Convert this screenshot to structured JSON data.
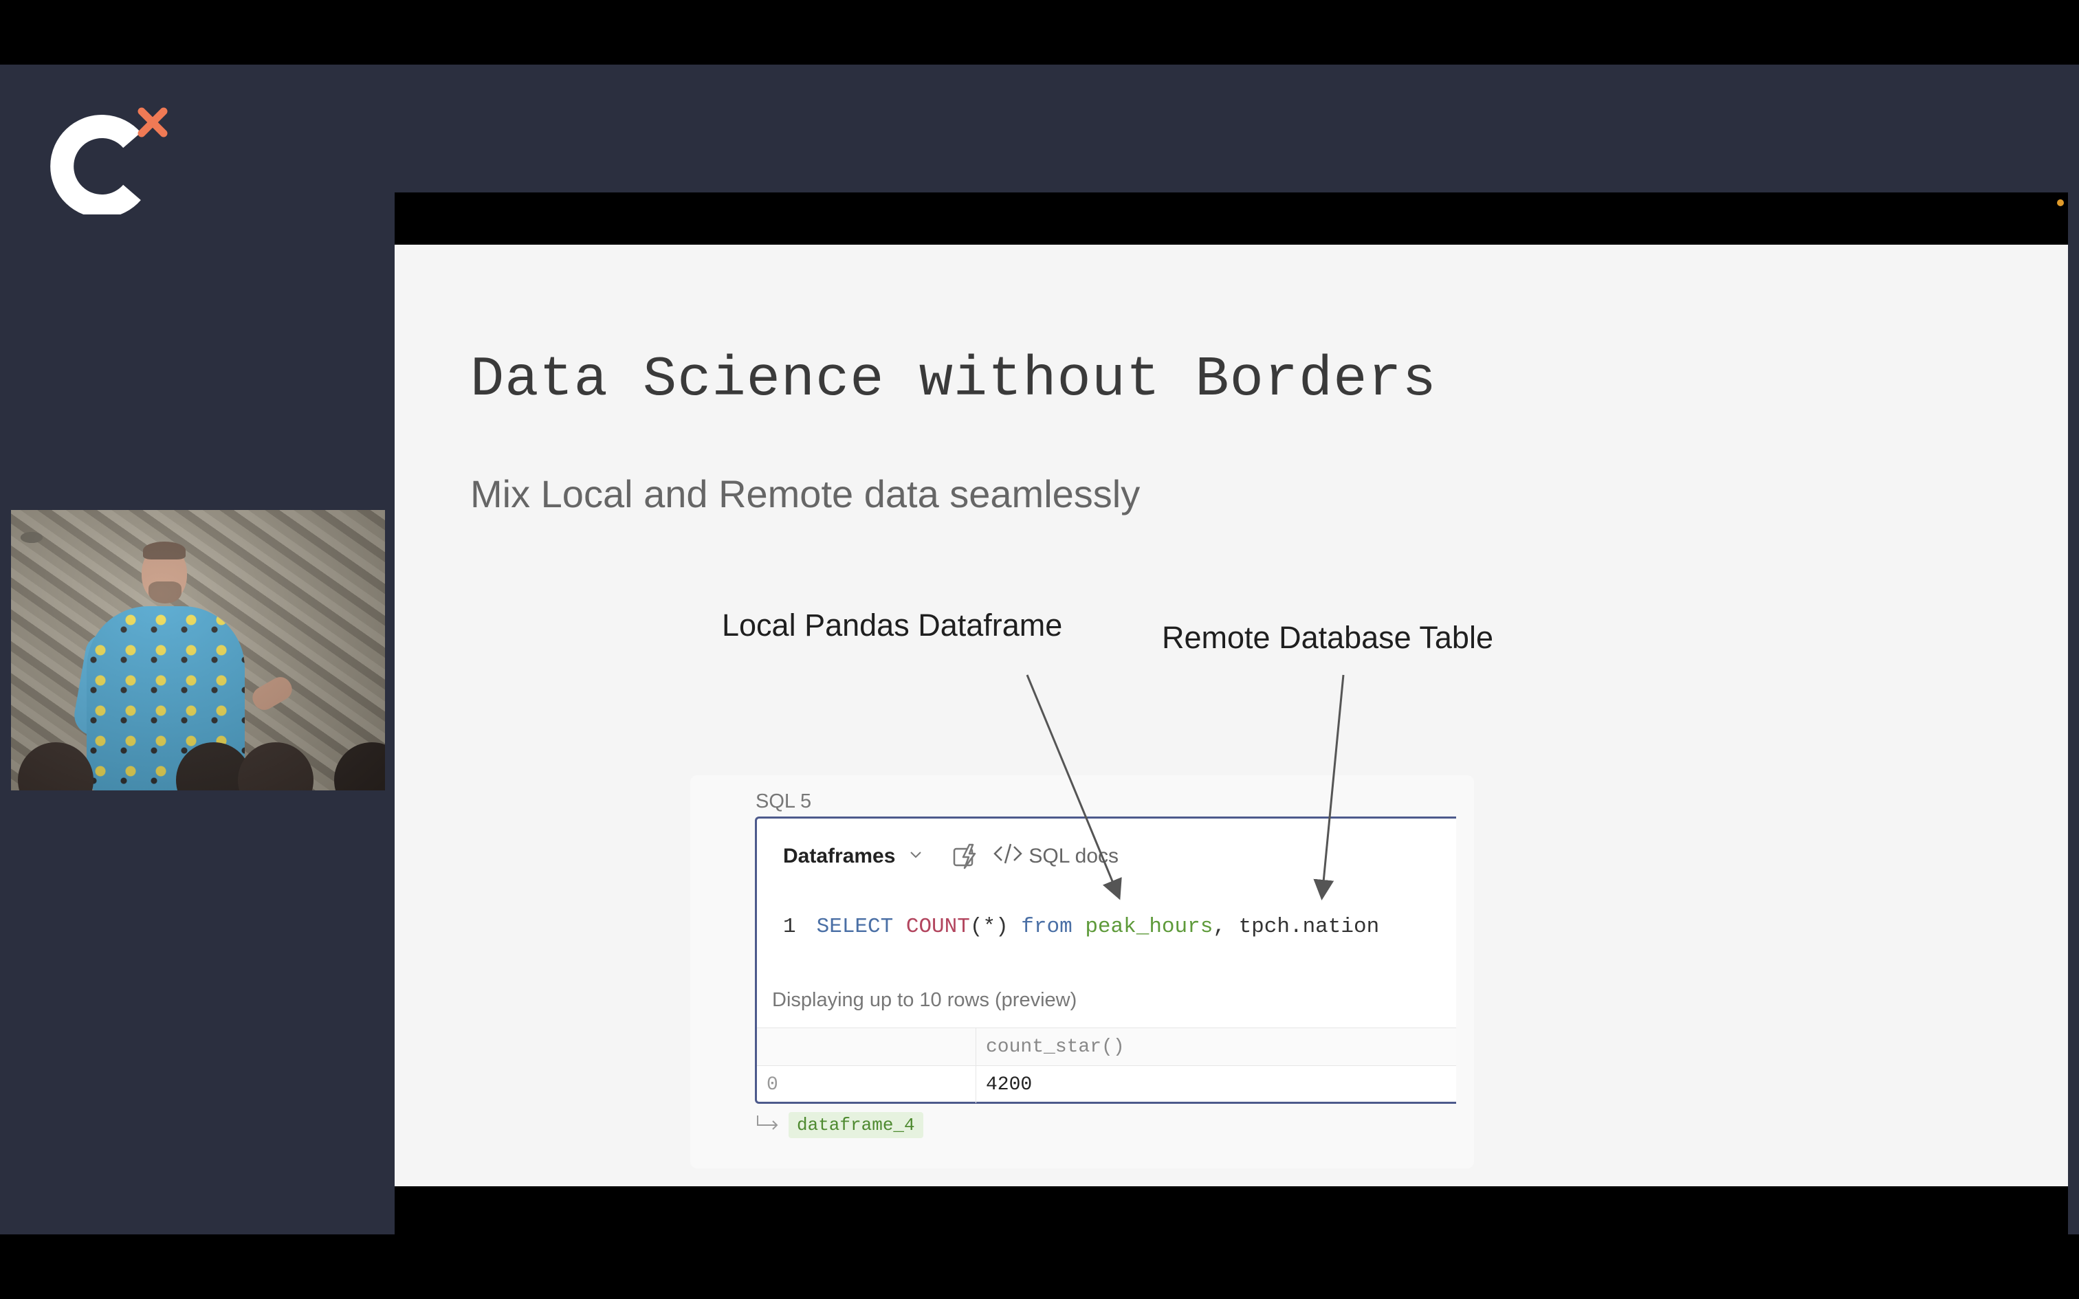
{
  "slide": {
    "title": "Data Science without Borders",
    "subtitle": "Mix Local and Remote data seamlessly",
    "callouts": {
      "local": "Local Pandas Dataframe",
      "remote": "Remote Database Table"
    }
  },
  "sql_cell": {
    "label": "SQL 5",
    "source_select": "Dataframes",
    "docs_link": "SQL docs",
    "code": {
      "line_number": "1",
      "tokens": {
        "select": "SELECT",
        "count": "COUNT",
        "args": "(*)",
        "from": "from",
        "local_table": "peak_hours",
        "comma": ",",
        "remote_table": "tpch.nation"
      }
    },
    "status": "Displaying up to 10 rows (preview)",
    "results": {
      "columns": [
        "",
        "count_star()"
      ],
      "rows": [
        [
          "0",
          "4200"
        ]
      ]
    },
    "output_variable": "dataframe_4"
  },
  "colors": {
    "stage_background": "#2b2f3f",
    "logo_accent": "#f07a55",
    "cell_border": "#4d5a8c",
    "sql_keyword": "#4a6fa5",
    "sql_function": "#b2455e",
    "sql_identifier": "#5e9a3a"
  },
  "icons": {
    "logo": "conference-logo",
    "dropdown": "chevron-down-icon",
    "ai": "lightning-icon",
    "docs": "code-icon",
    "output": "return-arrow-icon"
  }
}
